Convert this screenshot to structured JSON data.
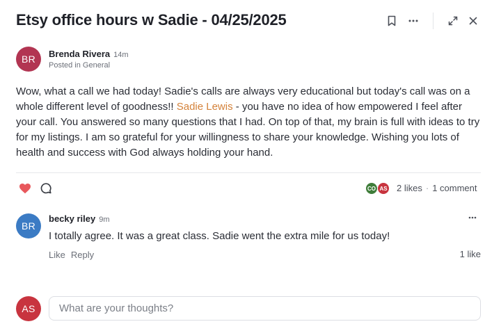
{
  "post": {
    "title": "Etsy office hours w Sadie - 04/25/2025",
    "author": {
      "initials": "BR",
      "name": "Brenda Rivera",
      "time": "14m",
      "posted_in": "Posted in General",
      "avatar_color": "#b23552"
    },
    "body": {
      "part1": "Wow, what a call we had today!   Sadie's calls are always very educational but today's call was on a whole different level of goodness!! ",
      "mention": "Sadie Lewis",
      "part2": " - you have no idea of how empowered I feel after your call.   You answered so many questions that I had.  On top of that, my brain is full with ideas to try for my listings.  I am so grateful for your willingness to share your knowledge.  Wishing you lots of health and success with God always holding your hand."
    },
    "likers": [
      {
        "initials": "CO",
        "color": "#3f7d3a"
      },
      {
        "initials": "AS",
        "color": "#c8343f"
      }
    ],
    "likes": "2 likes",
    "separator": "·",
    "comments_count": "1 comment"
  },
  "header_icons": [
    "bookmark-icon",
    "more-icon",
    "expand-icon",
    "close-icon"
  ],
  "comment": {
    "initials": "BR",
    "avatar_color": "#3b7bc4",
    "name": "becky riley",
    "time": "9m",
    "text": "I totally agree.  It was a great class.  Sadie went the extra mile for us today!",
    "like_label": "Like",
    "reply_label": "Reply",
    "likes": "1 like"
  },
  "reply": {
    "initials": "AS",
    "avatar_color": "#c8343f",
    "placeholder": "What are your thoughts?"
  },
  "colors": {
    "heart": "#e8585c",
    "mention": "#d4823a"
  }
}
